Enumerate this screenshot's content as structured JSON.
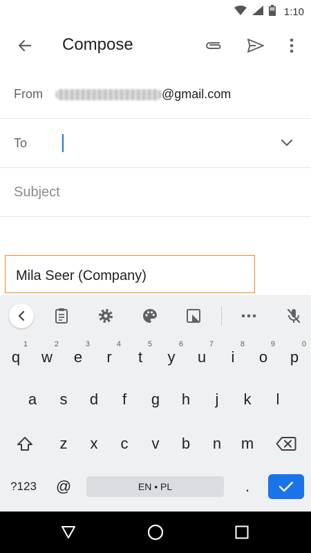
{
  "status_bar": {
    "time": "1:10"
  },
  "app_bar": {
    "title": "Compose"
  },
  "fields": {
    "from_label": "From",
    "from_domain": "@gmail.com",
    "to_label": "To",
    "subject_placeholder": "Subject"
  },
  "suggestion": {
    "text": "Mila Seer (Company)"
  },
  "keyboard": {
    "row1": [
      {
        "key": "q",
        "hint": "1"
      },
      {
        "key": "w",
        "hint": "2"
      },
      {
        "key": "e",
        "hint": "3"
      },
      {
        "key": "r",
        "hint": "4"
      },
      {
        "key": "t",
        "hint": "5"
      },
      {
        "key": "y",
        "hint": "6"
      },
      {
        "key": "u",
        "hint": "7"
      },
      {
        "key": "i",
        "hint": "8"
      },
      {
        "key": "o",
        "hint": "9"
      },
      {
        "key": "p",
        "hint": "0"
      }
    ],
    "row2": [
      "a",
      "s",
      "d",
      "f",
      "g",
      "h",
      "j",
      "k",
      "l"
    ],
    "row3": [
      "z",
      "x",
      "c",
      "v",
      "b",
      "n",
      "m"
    ],
    "symbols_label": "?123",
    "at_label": "@",
    "space_label": "EN • PL",
    "period_label": "."
  },
  "colors": {
    "accent": "#1a73e8",
    "suggestion_border": "#ef8a1f",
    "keyboard_bg": "#eef0f1"
  }
}
